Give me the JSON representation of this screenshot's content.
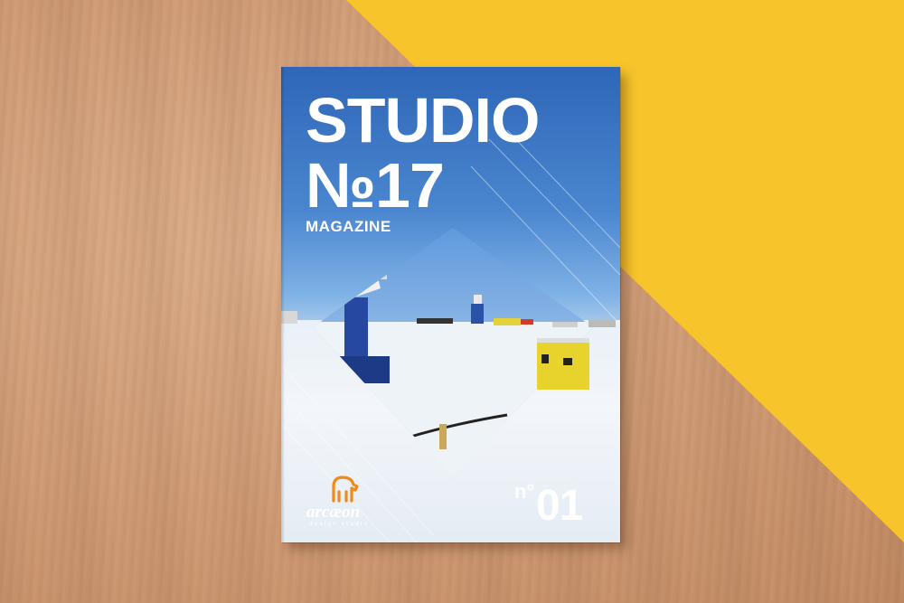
{
  "cover": {
    "title_line1": "STUDIO",
    "title_line2": "№17",
    "title_line3": "MAGAZINE",
    "issue_prefix": "n°",
    "issue_number": "01",
    "publisher_logo": {
      "name": "arcæon",
      "tagline": "design studio",
      "icon": "horse-icon"
    }
  },
  "colors": {
    "wood": "#cf9a74",
    "yellow": "#f8c42b",
    "sky": "#2f66b8",
    "snow": "#eef3f8",
    "logo_orange": "#f08a1c",
    "text_white": "#ffffff"
  }
}
